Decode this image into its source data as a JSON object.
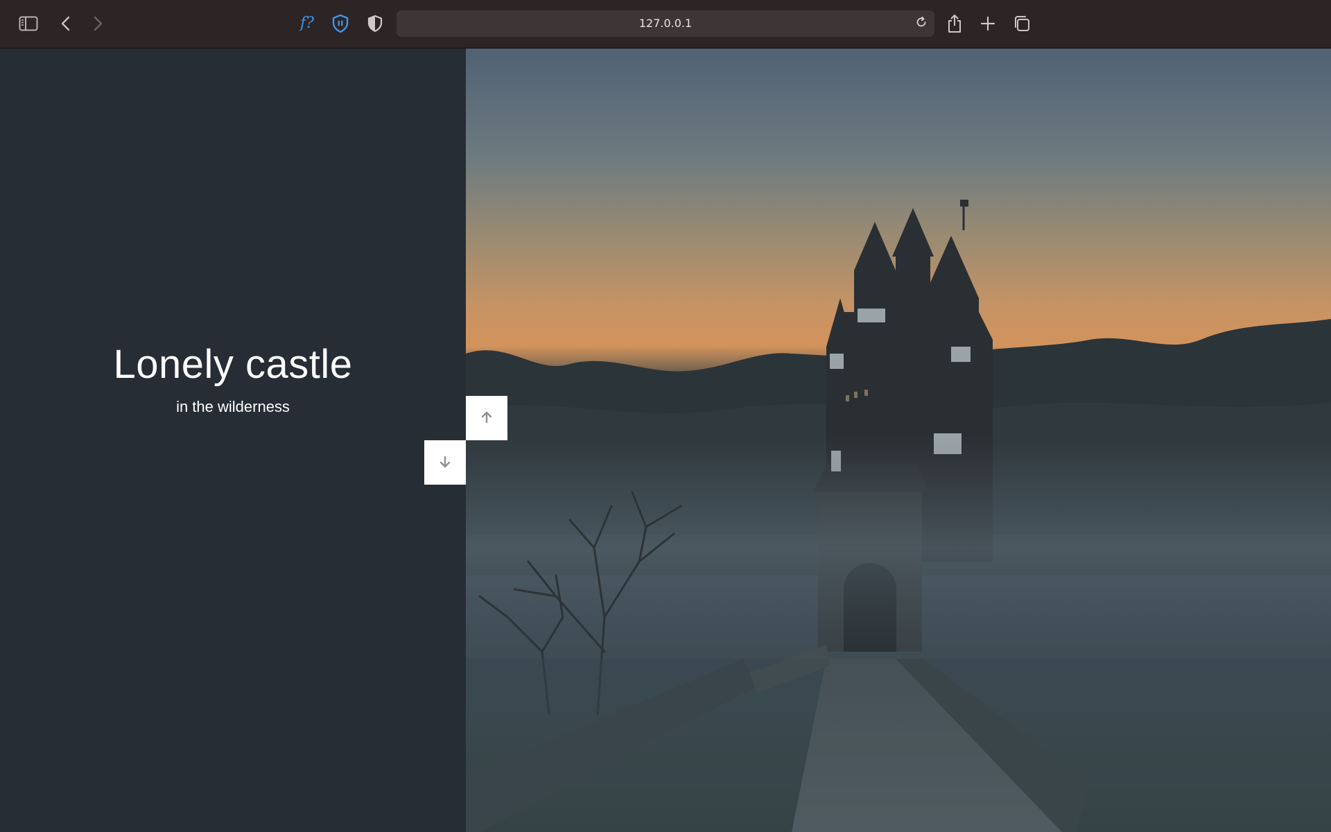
{
  "browser": {
    "url": "127.0.0.1",
    "font_tool_glyph": "f?"
  },
  "slide": {
    "title": "Lonely castle",
    "subtitle": "in the wilderness",
    "image_subject": "castle on a hill at dusk with fog and a stone bridge"
  },
  "navigation": {
    "up_icon": "arrow-up-icon",
    "down_icon": "arrow-down-icon"
  },
  "colors": {
    "panel_background": "#262d35",
    "toolbar_background": "#2d2426",
    "accent_blue": "#3e96e6",
    "nav_button_background": "#ffffff"
  }
}
